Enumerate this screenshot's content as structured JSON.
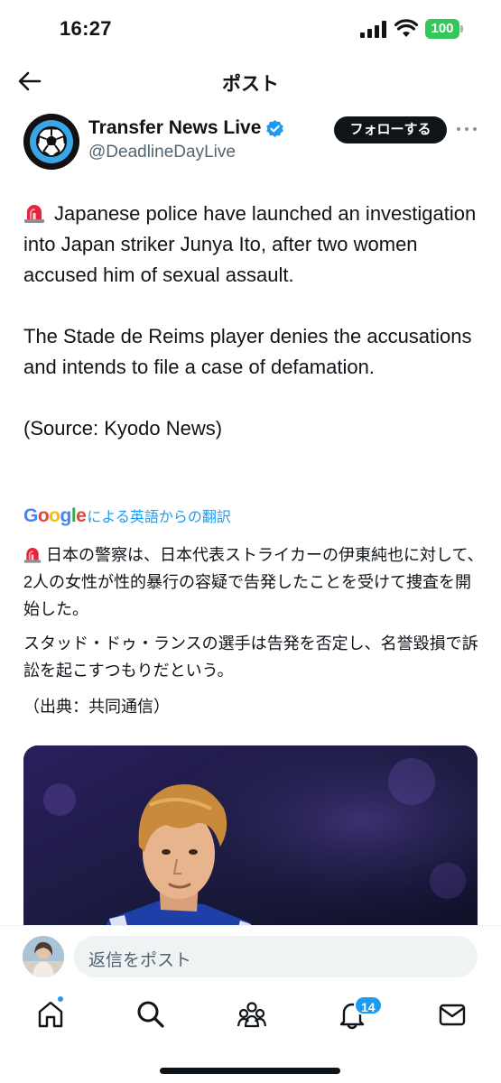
{
  "status_bar": {
    "time": "16:27",
    "battery": "100"
  },
  "header": {
    "title": "ポスト"
  },
  "author": {
    "name": "Transfer News Live",
    "handle": "@DeadlineDayLive"
  },
  "follow_button": "フォローする",
  "post": {
    "paragraph1": "Japanese police have launched an investigation into Japan striker Junya Ito, after two women accused him of sexual assault.",
    "paragraph2": "The Stade de Reims player denies the accusations and intends to file a case of defamation.",
    "paragraph3": "(Source: Kyodo News)"
  },
  "translation": {
    "provider": "Google",
    "label": "による英語からの翻訳",
    "paragraph1": "日本の警察は、日本代表ストライカーの伊東純也に対して、2人の女性が性的暴行の容疑で告発したことを受けて捜査を開始した。",
    "paragraph2": "スタッド・ドゥ・ランスの選手は告発を否定し、名誉毀損で訴訟を起こすつもりだという。",
    "paragraph3": "（出典：共同通信）"
  },
  "reply": {
    "placeholder": "返信をポスト"
  },
  "nav": {
    "notifications_badge": "14"
  },
  "colors": {
    "accent": "#1d9bf0",
    "text": "#0f1419",
    "secondary": "#536471",
    "battery": "#34c759"
  },
  "icons": [
    "back-arrow-icon",
    "verified-icon",
    "more-icon",
    "siren-icon",
    "home-icon",
    "search-icon",
    "communities-icon",
    "bell-icon",
    "mail-icon"
  ]
}
